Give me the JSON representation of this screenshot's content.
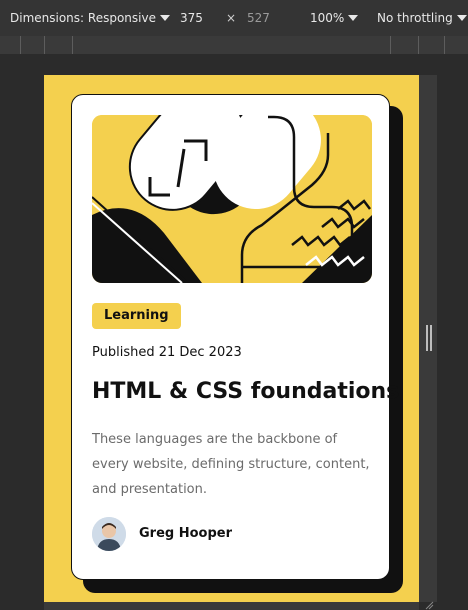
{
  "devtools": {
    "dimensions_label": "Dimensions: Responsive",
    "width_value": "375",
    "times": "×",
    "height_value": "527",
    "zoom_label": "100%",
    "throttle_label": "No throttling"
  },
  "card": {
    "tag": "Learning",
    "published": "Published 21 Dec 2023",
    "title": "HTML & CSS foundations",
    "description": "These languages are the backbone of every website, defining structure, content, and presentation.",
    "author": "Greg Hooper"
  },
  "colors": {
    "accent": "#f4d04e",
    "ink": "#111111",
    "muted": "#6b6b6b",
    "toolbar": "#343434"
  }
}
